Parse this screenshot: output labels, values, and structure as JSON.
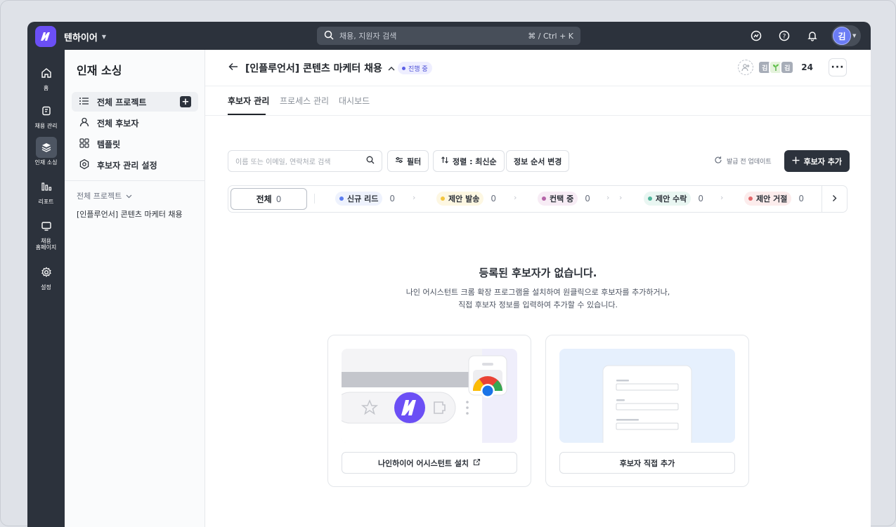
{
  "topbar": {
    "workspace": "텐하이어",
    "search_placeholder": "채용, 지원자 검색",
    "search_shortcut": "⌘ / Ctrl + K",
    "user_initial": "김"
  },
  "rail": [
    {
      "label": "홈",
      "icon": "home-icon"
    },
    {
      "label": "채용 관리",
      "icon": "clipboard-icon"
    },
    {
      "label": "인재 소싱",
      "icon": "layers-icon"
    },
    {
      "label": "리포트",
      "icon": "bar-chart-icon"
    },
    {
      "label": "채용\n홈페이지",
      "icon": "monitor-icon"
    },
    {
      "label": "설정",
      "icon": "gear-icon"
    }
  ],
  "sidebar": {
    "title": "인재 소싱",
    "items": [
      {
        "label": "전체 프로젝트",
        "icon": "list-icon"
      },
      {
        "label": "전체 후보자",
        "icon": "person-icon"
      },
      {
        "label": "템플릿",
        "icon": "grid-icon"
      },
      {
        "label": "후보자 관리 설정",
        "icon": "settings-hex-icon"
      }
    ],
    "section_label": "전체 프로젝트",
    "project": "[인플루언서] 콘텐츠 마케터 채용"
  },
  "header": {
    "title": "[인플루언서] 콘텐츠 마케터 채용",
    "status": "진행 중",
    "member_initials": [
      "김",
      "",
      "김"
    ],
    "member_count": "24"
  },
  "tabs": [
    "후보자 관리",
    "프로세스 관리",
    "대시보드"
  ],
  "toolbar": {
    "search_placeholder": "이름 또는 이메일, 연락처로 검색",
    "filter": "필터",
    "sort": "정렬 : 최신순",
    "order": "정보 순서 변경",
    "refresh": "발급 전 업데이트",
    "add": "후보자 추가"
  },
  "stages": {
    "all": {
      "label": "전체",
      "count": "0"
    },
    "items": [
      {
        "label": "신규 리드",
        "count": "0",
        "color": "#5b7cf0",
        "bg": "#eef2fd"
      },
      {
        "label": "제안 발송",
        "count": "0",
        "color": "#f2c641",
        "bg": "#fdf7e2"
      },
      {
        "label": "컨택 중",
        "count": "0",
        "color": "#b565a8",
        "bg": "#f7ecf5"
      },
      {
        "label": "제안 수락",
        "count": "0",
        "color": "#4fb49a",
        "bg": "#e9f6f2"
      },
      {
        "label": "제안 거절",
        "count": "0",
        "color": "#e2686b",
        "bg": "#fcecec"
      }
    ]
  },
  "empty": {
    "title": "등록된 후보자가 없습니다.",
    "line1": "나인 어시스턴트 크롬 확장 프로그램을 설치하여 원클릭으로 후보자를 추가하거나,",
    "line2": "직접 후보자 정보를 입력하여 추가할 수 있습니다."
  },
  "cards": {
    "install": "나인하이어 어시스턴트 설치",
    "manual": "후보자 직접 추가"
  },
  "colors": {
    "brand": "#6b4ff5",
    "topbar": "#2c323c"
  }
}
